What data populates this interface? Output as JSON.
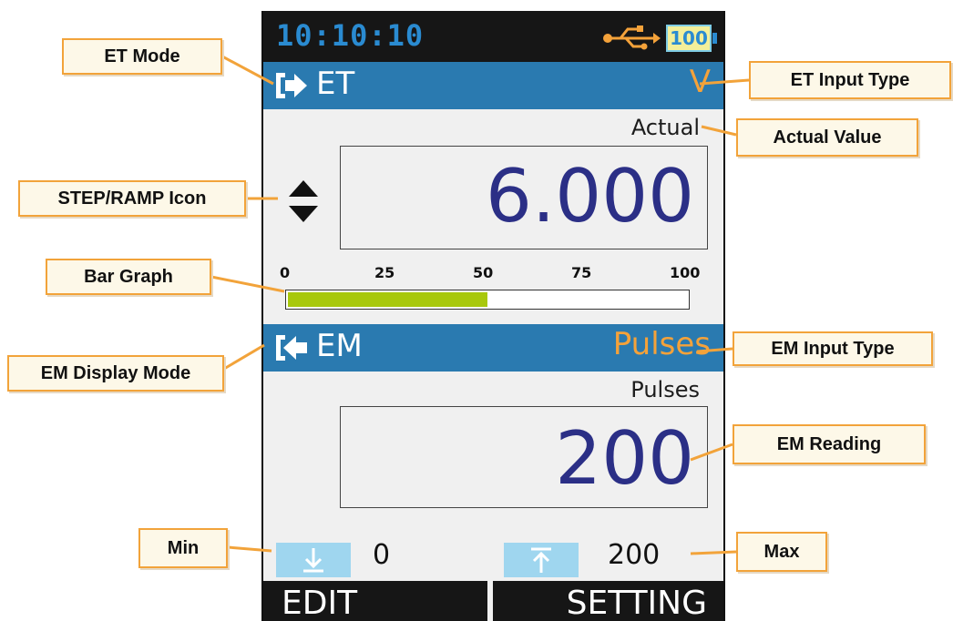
{
  "status": {
    "time": "10:10:10",
    "battery": "100"
  },
  "et": {
    "mode": "ET",
    "input_type": "V",
    "unit_label": "Actual",
    "value": "6.000"
  },
  "bar_graph": {
    "scale": [
      "0",
      "25",
      "50",
      "75",
      "100"
    ],
    "fill_percent": 50
  },
  "em": {
    "mode": "EM",
    "input_type": "Pulses",
    "unit_label": "Pulses",
    "reading": "200"
  },
  "min": {
    "value": "0"
  },
  "max": {
    "value": "200"
  },
  "softkeys": {
    "left": "EDIT",
    "right": "SETTING"
  },
  "callouts": {
    "et_mode": "ET Mode",
    "et_input_type": "ET Input Type",
    "actual_value": "Actual Value",
    "step_ramp_icon": "STEP/RAMP Icon",
    "bar_graph": "Bar Graph",
    "em_input_type": "EM Input Type",
    "em_display_mode": "EM Display Mode",
    "em_reading": "EM Reading",
    "min": "Min",
    "max": "Max"
  },
  "colors": {
    "section_bar": "#2a7ab0",
    "input_type": "#f4a23a",
    "value_text": "#2b2f86",
    "bar_fill": "#a8c80c",
    "callout_border": "#f2a33a",
    "clock": "#2a8bd1"
  }
}
